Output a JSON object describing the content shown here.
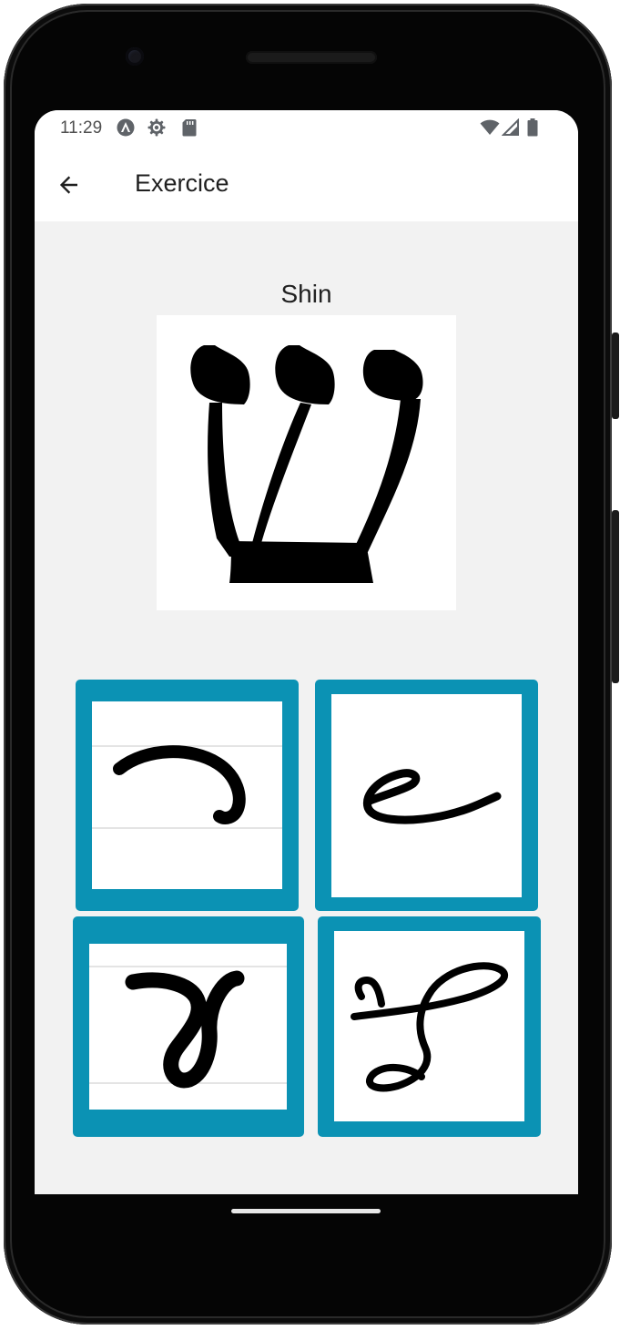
{
  "status_bar": {
    "time": "11:29",
    "icons": [
      "accessibility-a-icon",
      "settings-gear-icon",
      "sd-card-icon",
      "wifi-icon",
      "signal-icon",
      "battery-icon"
    ]
  },
  "app_bar": {
    "title": "Exercice",
    "back_icon": "arrow-left-icon"
  },
  "exercise": {
    "letter_name": "Shin",
    "choices": [
      {
        "id": "choice-1",
        "glyph": "cursive-resh"
      },
      {
        "id": "choice-2",
        "glyph": "cursive-shin"
      },
      {
        "id": "choice-3",
        "glyph": "cursive-tet"
      },
      {
        "id": "choice-4",
        "glyph": "cursive-pe"
      }
    ]
  },
  "colors": {
    "accent": "#0b92b4",
    "screen_bg": "#f2f2f2",
    "bar_bg": "#ffffff"
  }
}
